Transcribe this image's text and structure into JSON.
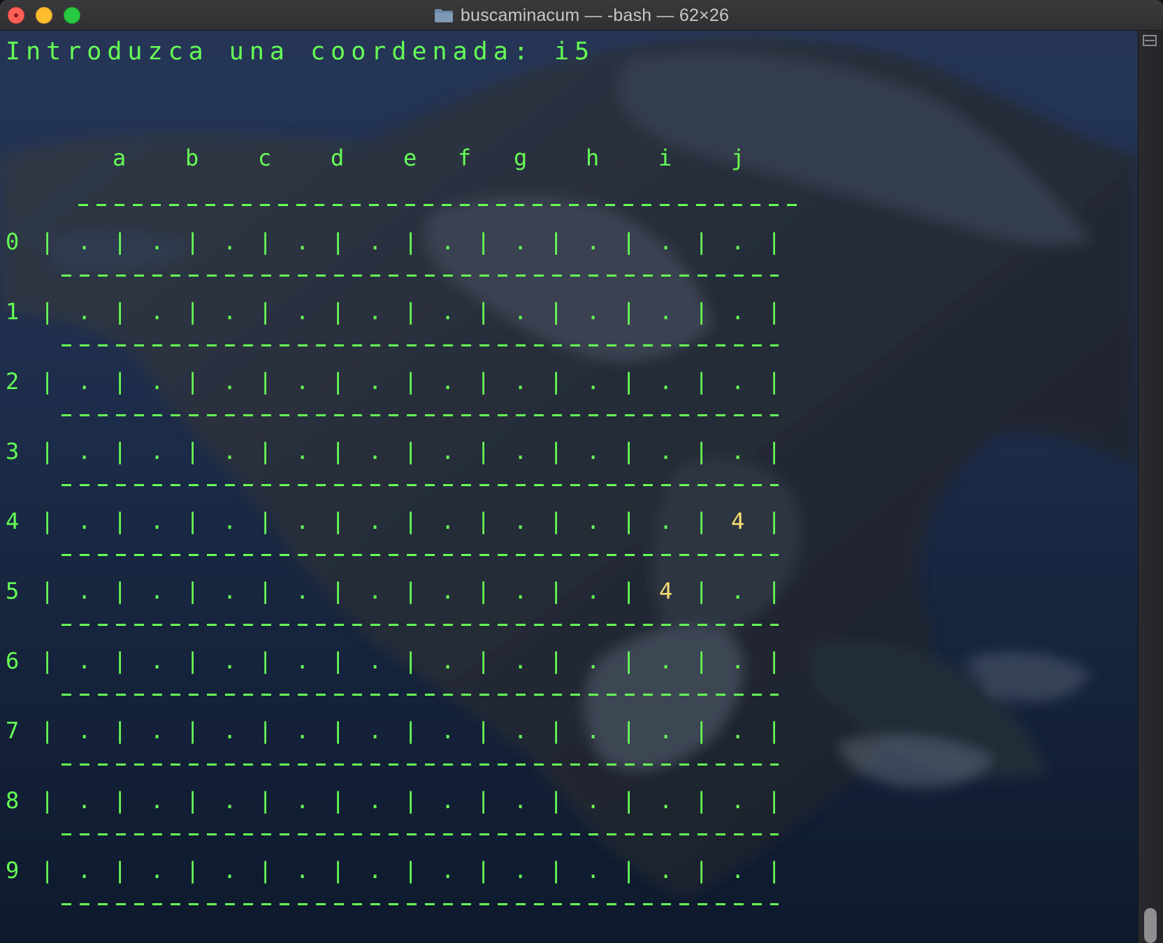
{
  "window": {
    "title": "buscaminacum — -bash — 62×26",
    "icon": "folder-icon"
  },
  "terminal": {
    "prompt_line": "Introduzca una coordenada: i5",
    "text_color": "#66ff55",
    "number_color": "#f6de73"
  },
  "board": {
    "column_headers": [
      "a",
      "b",
      "c",
      "d",
      "e",
      "f",
      "g",
      "h",
      "i",
      "j"
    ],
    "row_labels": [
      "0",
      "1",
      "2",
      "3",
      "4",
      "5",
      "6",
      "7",
      "8",
      "9"
    ],
    "separator": "----------------------------------------",
    "rows": [
      [
        ".",
        ".",
        ".",
        ".",
        ".",
        ".",
        ".",
        ".",
        ".",
        "."
      ],
      [
        ".",
        ".",
        ".",
        ".",
        ".",
        ".",
        ".",
        ".",
        ".",
        "."
      ],
      [
        ".",
        ".",
        ".",
        ".",
        ".",
        ".",
        ".",
        ".",
        ".",
        "."
      ],
      [
        ".",
        ".",
        ".",
        ".",
        ".",
        ".",
        ".",
        ".",
        ".",
        "."
      ],
      [
        ".",
        ".",
        ".",
        ".",
        ".",
        ".",
        ".",
        ".",
        ".",
        "4"
      ],
      [
        ".",
        ".",
        ".",
        ".",
        ".",
        ".",
        ".",
        ".",
        "4",
        "."
      ],
      [
        ".",
        ".",
        ".",
        ".",
        ".",
        ".",
        ".",
        ".",
        ".",
        "."
      ],
      [
        ".",
        ".",
        ".",
        ".",
        ".",
        ".",
        ".",
        ".",
        ".",
        "."
      ],
      [
        ".",
        ".",
        ".",
        ".",
        ".",
        ".",
        ".",
        ".",
        ".",
        "."
      ],
      [
        ".",
        ".",
        ".",
        ".",
        ".",
        ".",
        ".",
        ".",
        ".",
        "."
      ]
    ],
    "cell_divider": "|"
  }
}
